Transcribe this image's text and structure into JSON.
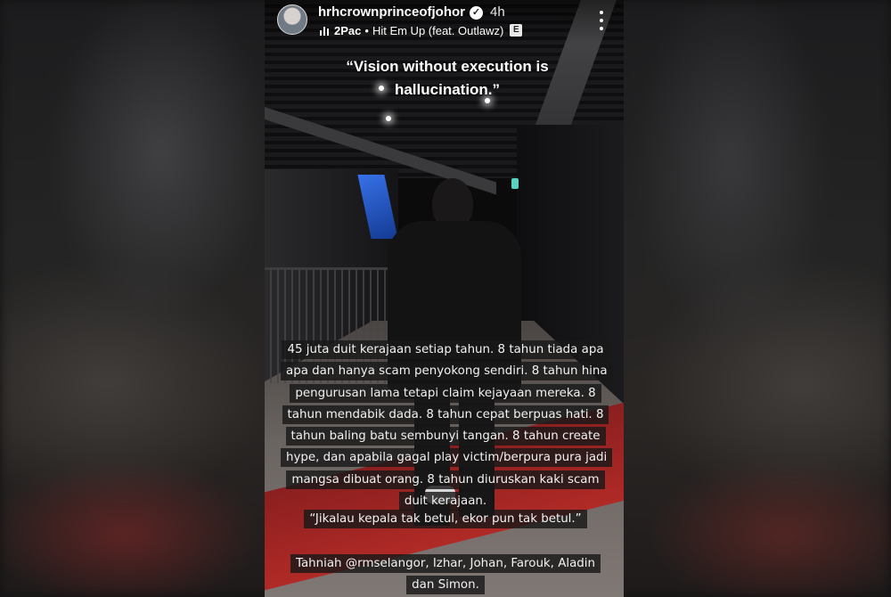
{
  "story": {
    "header": {
      "username": "hrhcrownprinceofjohor",
      "time": "4h",
      "music": {
        "artist": "2Pac",
        "separator": "•",
        "track": "Hit Em Up (feat. Outlawz)",
        "explicit_badge": "E"
      }
    },
    "quote": "“Vision without execution is hallucination.”",
    "captions": {
      "main": "45 juta duit kerajaan setiap tahun. 8 tahun tiada apa apa dan hanya scam penyokong sendiri. 8 tahun hina pengurusan lama tetapi claim kejayaan mereka. 8 tahun mendabik dada. 8 tahun cepat berpuas hati. 8 tahun baling batu sembunyi tangan. 8 tahun create hype, dan apabila gagal play victim/berpura pura jadi mangsa dibuat orang. 8 tahun diuruskan kaki scam duit kerajaan.",
      "saying": "“Jikalau  kepala tak betul, ekor pun tak betul.”",
      "thanks": "Tahniah @rmselangor, Izhar, Johan, Farouk, Aladin dan Simon."
    }
  }
}
